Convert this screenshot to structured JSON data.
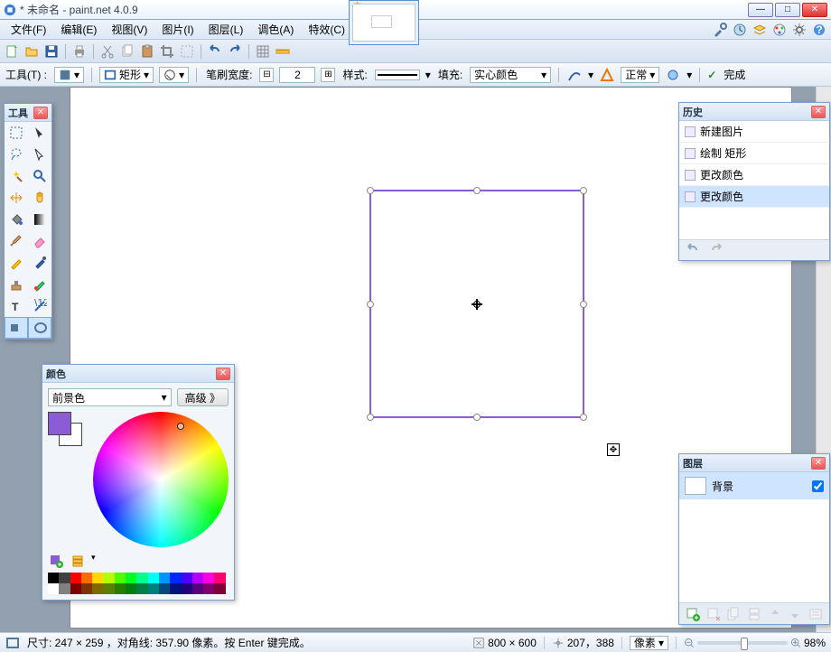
{
  "title": "* 未命名 - paint.net 4.0.9",
  "window_buttons": {
    "min": "—",
    "max": "□",
    "close": "✕"
  },
  "menu": [
    "文件(F)",
    "编辑(E)",
    "视图(V)",
    "图片(I)",
    "图层(L)",
    "调色(A)",
    "特效(C)"
  ],
  "menu_icons": [
    "wrench-icon",
    "clock-icon",
    "layers-icon",
    "palette-icon",
    "gear-icon",
    "help-icon"
  ],
  "options": {
    "tool_label": "工具(T) :",
    "shape_label": "矩形",
    "brush_label": "笔刷宽度:",
    "brush_value": "2",
    "style_label": "样式:",
    "fill_label": "填充:",
    "fill_value": "实心颜色",
    "curve_label": "",
    "blend_label": "正常",
    "finish_label": "完成"
  },
  "tools_panel": {
    "title": "工具"
  },
  "tool_names": [
    "rect-select",
    "move-selection",
    "lasso",
    "move-pixels",
    "wand",
    "zoom",
    "pan",
    "hand",
    "fill",
    "gradient",
    "brush",
    "eraser",
    "pencil",
    "eyedropper",
    "clone",
    "recolor",
    "text",
    "line",
    "shapes",
    "ellipse"
  ],
  "colors_panel": {
    "title": "颜色",
    "mode": "前景色",
    "advanced": "高级 》",
    "fg_color": "#8a5dd6",
    "bg_color": "#ffffff"
  },
  "palette": [
    "#000000",
    "#404040",
    "#ff0000",
    "#ff6a00",
    "#ffd800",
    "#b6ff00",
    "#4cff00",
    "#00ff21",
    "#00ff90",
    "#00ffff",
    "#0094ff",
    "#0026ff",
    "#4800ff",
    "#b200ff",
    "#ff00dc",
    "#ff006e",
    "#ffffff",
    "#808080",
    "#7f0000",
    "#7f3300",
    "#7f6a00",
    "#5b7f00",
    "#267f00",
    "#007f0e",
    "#007f46",
    "#007f7f",
    "#004a7f",
    "#00137f",
    "#24007f",
    "#57007f",
    "#7f006e",
    "#7f0037"
  ],
  "history_panel": {
    "title": "历史",
    "items": [
      "新建图片",
      "绘制 矩形",
      "更改颜色",
      "更改颜色"
    ],
    "selected": 3
  },
  "layers_panel": {
    "title": "图层",
    "items": [
      {
        "name": "背景",
        "visible": true
      }
    ]
  },
  "status": {
    "size_label": "尺寸: 247 × 259 ，对角线: 357.90 像素。按 Enter 键完成。",
    "canvas_size": "800 × 600",
    "cursor": "207，388",
    "units": "像素",
    "zoom": "98%"
  }
}
